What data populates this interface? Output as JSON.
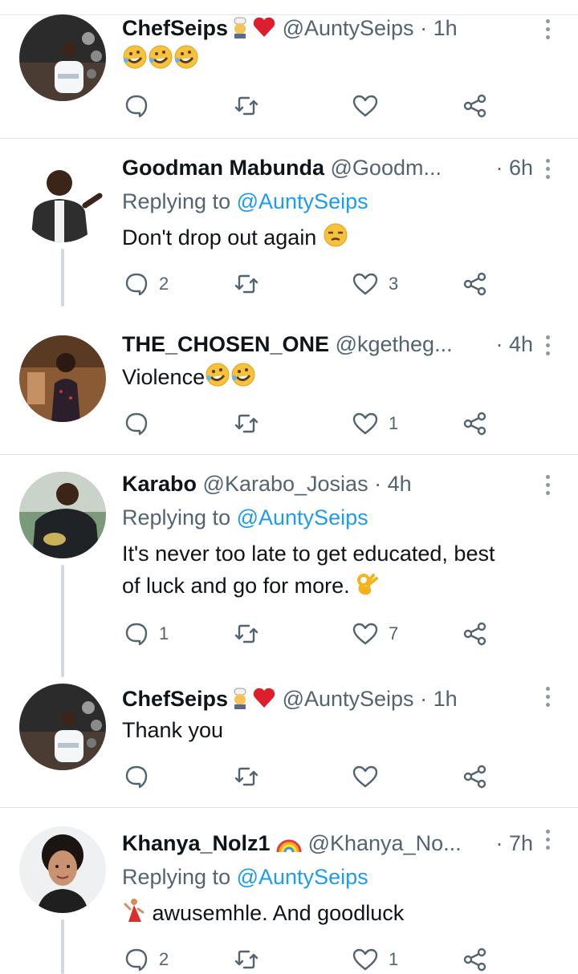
{
  "tweets": [
    {
      "name": "ChefSeips",
      "name_emojis": [
        "cook-emoji",
        "red-heart-emoji"
      ],
      "handle": "@AuntySeips",
      "time": "· 1h",
      "replying_label": "",
      "replying_to": "",
      "text": "",
      "text_emojis": [
        "rolling-laughing-emoji",
        "rolling-laughing-emoji",
        "rolling-laughing-emoji"
      ],
      "replies": "",
      "likes": ""
    },
    {
      "name": "Goodman Mabunda",
      "handle": "@Goodm...",
      "time": "· 6h",
      "replying_label": "Replying to",
      "replying_to": "@AuntySeips",
      "text": "Don't drop out again",
      "text_emojis": [
        "unamused-face-emoji"
      ],
      "replies": "2",
      "likes": "3"
    },
    {
      "name": "THE_CHOSEN_ONE",
      "handle": "@kgetheg...",
      "time": "· 4h",
      "text": "Violence",
      "text_emojis": [
        "rolling-laughing-emoji",
        "rolling-laughing-emoji"
      ],
      "replies": "",
      "likes": "1"
    },
    {
      "name": "Karabo",
      "handle": "@Karabo_Josias",
      "time": "· 4h",
      "replying_label": "Replying to",
      "replying_to": "@AuntySeips",
      "text_line1": "It's never too late to get educated, best",
      "text_line2": "of luck and go for more.",
      "text_emojis": [
        "ok-hand-emoji"
      ],
      "replies": "1",
      "likes": "7"
    },
    {
      "name": "ChefSeips",
      "name_emojis": [
        "cook-emoji",
        "red-heart-emoji"
      ],
      "handle": "@AuntySeips",
      "time": "· 1h",
      "text": "Thank you",
      "replies": "",
      "likes": ""
    },
    {
      "name": "Khanya_Nolz1",
      "name_emojis": [
        "rainbow-emoji"
      ],
      "handle": "@Khanya_No...",
      "time": "· 7h",
      "replying_label": "Replying to",
      "replying_to": "@AuntySeips",
      "text": "awusemhle. And goodluck",
      "text_emojis": [
        "dancer-emoji"
      ],
      "replies": "2",
      "likes": "1"
    }
  ],
  "colors": {
    "text": "#0f1419",
    "secondary": "#536471",
    "link": "#1d9bf0",
    "divider": "#e1e6ea",
    "thread_line": "#cfd9de"
  }
}
